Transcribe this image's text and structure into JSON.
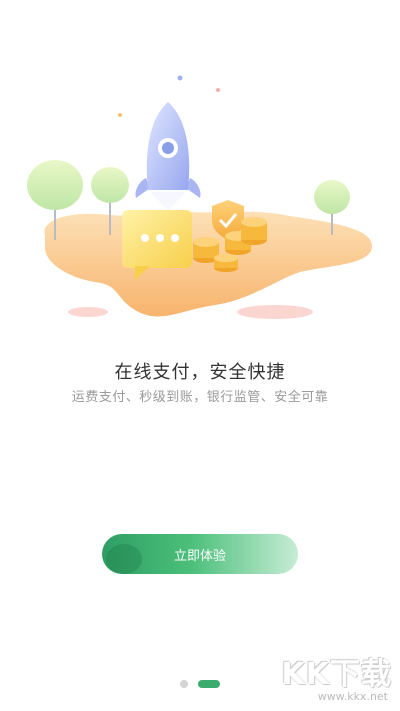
{
  "onboarding": {
    "title": "在线支付，安全快捷",
    "subtitle": "运费支付、秒级到账，银行监管、安全可靠",
    "cta_label": "立即体验",
    "page_index": 2,
    "page_count": 2
  },
  "watermark": {
    "text": "KK下载",
    "url": "www.kkx.net"
  },
  "colors": {
    "primary_green": "#3aad6e",
    "title_text": "#333333",
    "subtitle_text": "#9a9a9a",
    "island": "#fbc98f",
    "coin": "#f6b93b"
  }
}
